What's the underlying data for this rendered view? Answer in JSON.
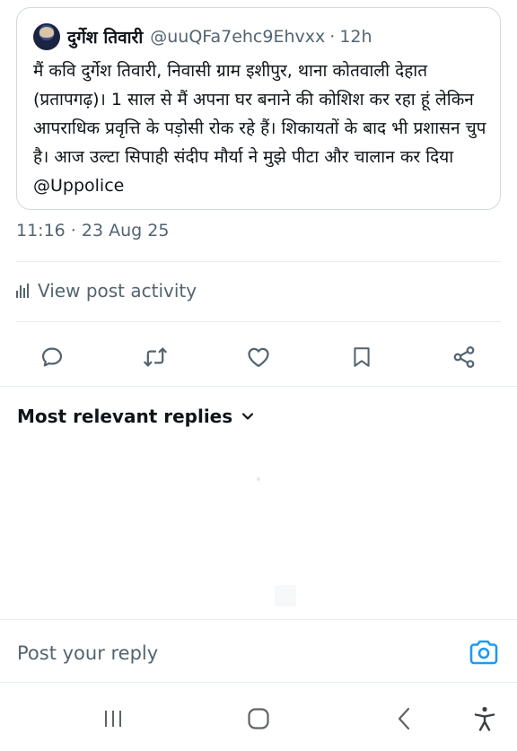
{
  "quote": {
    "author_name": "दुर्गेश तिवारी",
    "handle": "@uuQFa7ehc9Ehvxx",
    "separator": "·",
    "age": "12h",
    "text": "मैं कवि दुर्गेश तिवारी, निवासी ग्राम इशीपुर, थाना कोतवाली देहात (प्रतापगढ़)। 1 साल से मैं अपना घर बनाने की कोशिश कर रहा हूं लेकिन आपराधिक प्रवृत्ति के पड़ोसी रोक रहे हैं। शिकायतों के बाद भी प्रशासन चुप है। आज उल्टा सिपाही संदीप मौर्या ने मुझे पीटा और चालान कर दिया @Uppolice"
  },
  "post": {
    "timestamp": "11:16 · 23 Aug 25",
    "activity_label": "View post activity"
  },
  "actions": {
    "icons": [
      "reply-icon",
      "repost-icon",
      "like-icon",
      "bookmark-icon",
      "share-icon"
    ]
  },
  "replies": {
    "sort_label": "Most relevant replies"
  },
  "composer": {
    "placeholder": "Post your reply"
  },
  "colors": {
    "text_primary": "#0f1419",
    "text_secondary": "#536471",
    "accent": "#1d9bf0",
    "divider": "#e6ecf0"
  }
}
